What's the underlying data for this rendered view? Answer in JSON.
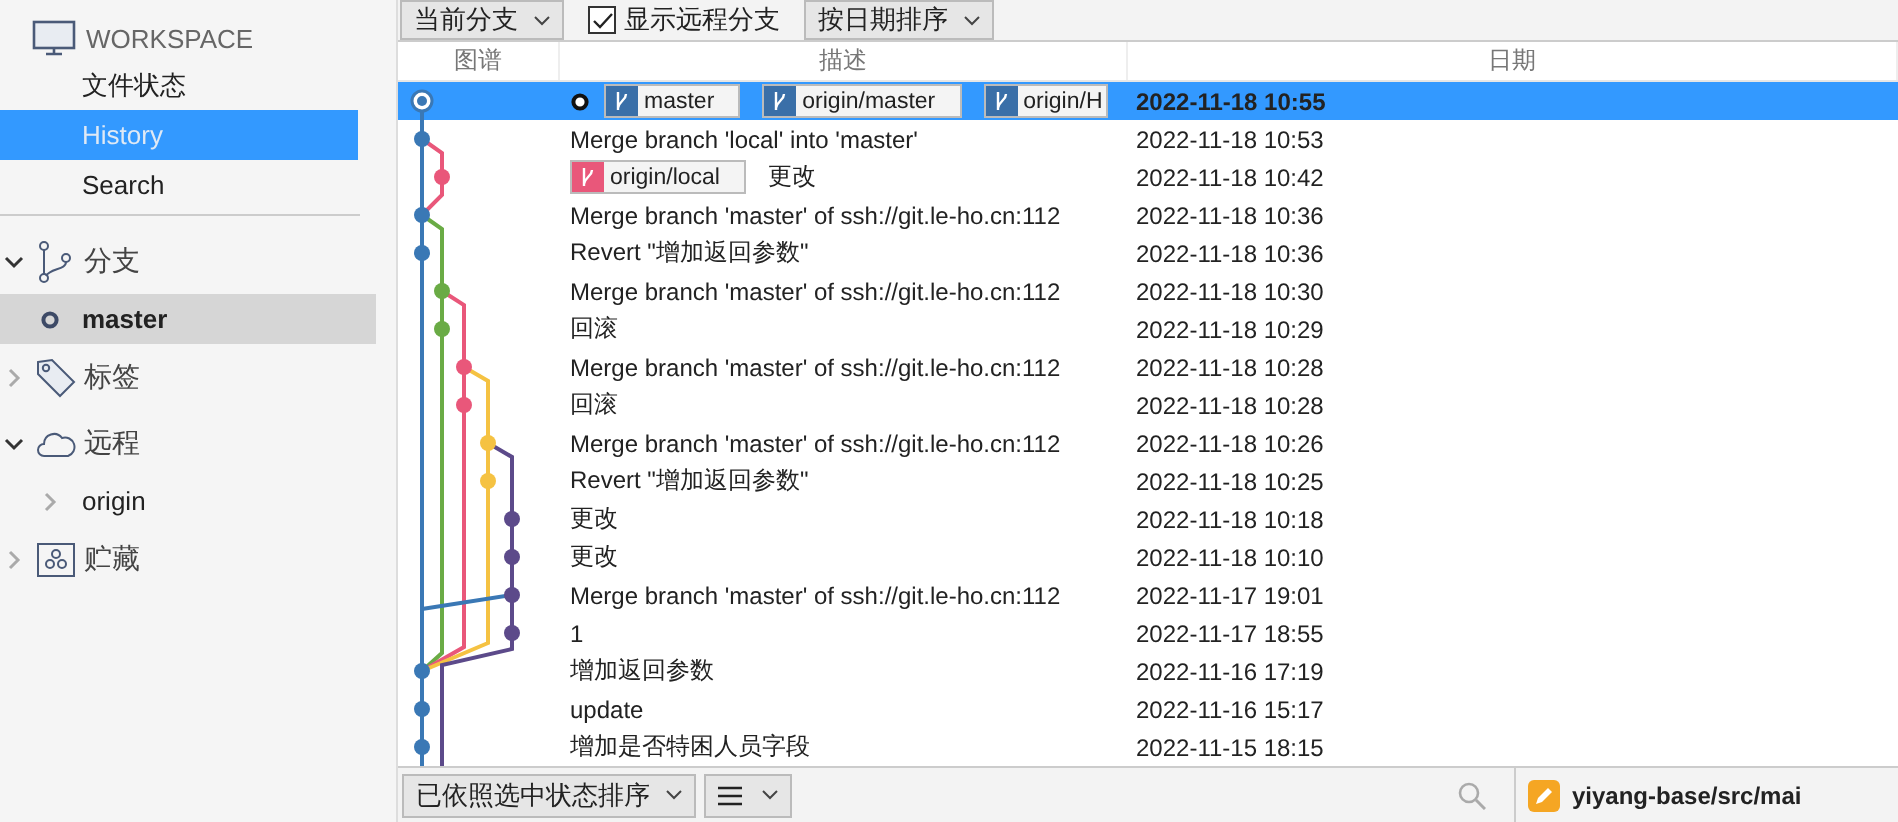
{
  "sidebar": {
    "workspace": {
      "title": "WORKSPACE",
      "items": [
        {
          "label": "文件状态",
          "selected": false
        },
        {
          "label": "History",
          "selected": true
        },
        {
          "label": "Search",
          "selected": false
        }
      ]
    },
    "sections": [
      {
        "label": "分支",
        "kind": "branches",
        "expanded": true,
        "children": [
          {
            "label": "master",
            "current": true,
            "selected": true
          }
        ]
      },
      {
        "label": "标签",
        "kind": "tags",
        "expanded": false
      },
      {
        "label": "远程",
        "kind": "remotes",
        "expanded": true,
        "children": [
          {
            "label": "origin",
            "current": false,
            "selected": false
          }
        ]
      },
      {
        "label": "贮藏",
        "kind": "stashes",
        "expanded": false
      }
    ]
  },
  "toolbar": {
    "branch_filter": "当前分支",
    "show_remote": {
      "label": "显示远程分支",
      "checked": true
    },
    "sort": "按日期排序"
  },
  "table": {
    "columns": [
      "图谱",
      "描述",
      "日期"
    ],
    "rows": [
      {
        "description": "",
        "date": "2022-11-18 10:55",
        "selected": true,
        "head": true,
        "refs": [
          {
            "label": "master",
            "color": "#3a6fa8"
          },
          {
            "label": "origin/master",
            "color": "#3a6fa8"
          },
          {
            "label": "origin/H",
            "color": "#3a6fa8"
          }
        ]
      },
      {
        "description": "Merge branch 'local' into 'master'",
        "date": "2022-11-18 10:53",
        "selected": false,
        "head": false,
        "refs": []
      },
      {
        "description": "更改",
        "date": "2022-11-18 10:42",
        "selected": false,
        "head": false,
        "refs": [
          {
            "label": "origin/local",
            "color": "#e9577a"
          }
        ]
      },
      {
        "description": "Merge branch 'master' of ssh://git.le-ho.cn:112",
        "date": "2022-11-18 10:36",
        "selected": false,
        "head": false,
        "refs": []
      },
      {
        "description": "Revert \"增加返回参数\"",
        "date": "2022-11-18 10:36",
        "selected": false,
        "head": false,
        "refs": []
      },
      {
        "description": "Merge branch 'master' of ssh://git.le-ho.cn:112",
        "date": "2022-11-18 10:30",
        "selected": false,
        "head": false,
        "refs": []
      },
      {
        "description": "回滚",
        "date": "2022-11-18 10:29",
        "selected": false,
        "head": false,
        "refs": []
      },
      {
        "description": "Merge branch 'master' of ssh://git.le-ho.cn:112",
        "date": "2022-11-18 10:28",
        "selected": false,
        "head": false,
        "refs": []
      },
      {
        "description": "回滚",
        "date": "2022-11-18 10:28",
        "selected": false,
        "head": false,
        "refs": []
      },
      {
        "description": "Merge branch 'master' of ssh://git.le-ho.cn:112",
        "date": "2022-11-18 10:26",
        "selected": false,
        "head": false,
        "refs": []
      },
      {
        "description": "Revert \"增加返回参数\"",
        "date": "2022-11-18 10:25",
        "selected": false,
        "head": false,
        "refs": []
      },
      {
        "description": "更改",
        "date": "2022-11-18 10:18",
        "selected": false,
        "head": false,
        "refs": []
      },
      {
        "description": "更改",
        "date": "2022-11-18 10:10",
        "selected": false,
        "head": false,
        "refs": []
      },
      {
        "description": "Merge branch 'master' of ssh://git.le-ho.cn:112",
        "date": "2022-11-17 19:01",
        "selected": false,
        "head": false,
        "refs": []
      },
      {
        "description": "1",
        "date": "2022-11-17 18:55",
        "selected": false,
        "head": false,
        "refs": []
      },
      {
        "description": "增加返回参数",
        "date": "2022-11-16 17:19",
        "selected": false,
        "head": false,
        "refs": []
      },
      {
        "description": "update",
        "date": "2022-11-16 15:17",
        "selected": false,
        "head": false,
        "refs": []
      },
      {
        "description": "增加是否特困人员字段",
        "date": "2022-11-15 18:15",
        "selected": false,
        "head": false,
        "refs": []
      }
    ]
  },
  "bottom_bar": {
    "sort": "已依照选中状态排序",
    "file_path": "yiyang-base/src/mai"
  }
}
